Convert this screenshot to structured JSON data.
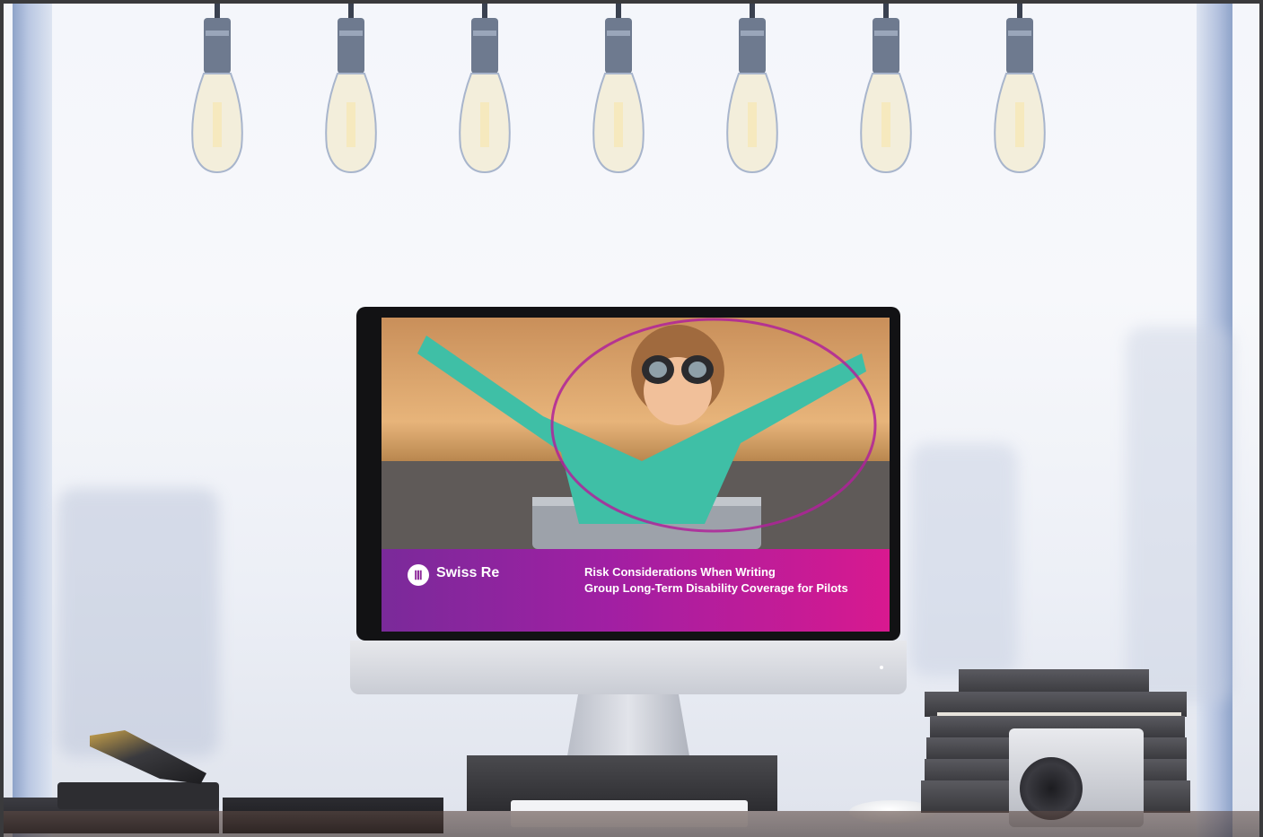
{
  "monitor_screen": {
    "brand": "Swiss Re",
    "title_line_1": "Risk Considerations When Writing",
    "title_line_2": "Group Long-Term Disability Coverage for Pilots",
    "banner_gradient": [
      "#7a2a9a",
      "#d8198f"
    ]
  },
  "scene": {
    "bulb_count": 7,
    "description_icons": [
      "light-bulb-icon",
      "swiss-re-logo-icon",
      "camera-icon",
      "stapler-icon"
    ]
  }
}
